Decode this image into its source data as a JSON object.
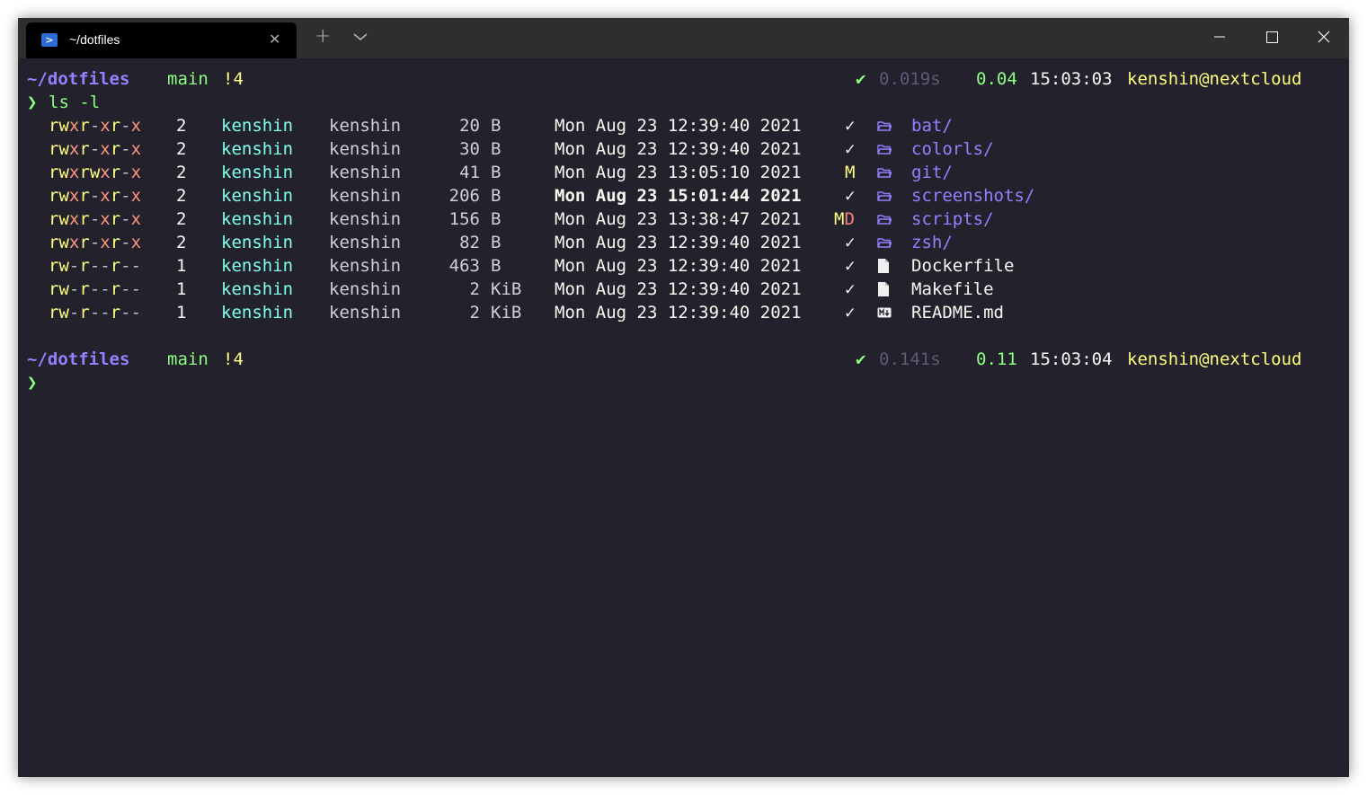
{
  "tab": {
    "title": "~/dotfiles",
    "icon": "powershell-icon",
    "close_glyph": "✕",
    "new_tab_glyph": "+"
  },
  "prompt1": {
    "path": "~/dotfiles",
    "branch_glyph": "",
    "branch": "main",
    "status": "!4",
    "check": "✔",
    "duration": "0.019s",
    "load_glyph": "",
    "load": "0.04",
    "time": "15:03:03",
    "user": "kenshin@nextcloud"
  },
  "command": {
    "chevron": "❯",
    "text": "ls -l"
  },
  "listing": [
    {
      "perm": [
        "r",
        "w",
        "x",
        "r",
        "-",
        "x",
        "r",
        "-",
        "x"
      ],
      "links": "2",
      "user": "kenshin",
      "group": "kenshin",
      "size": "20",
      "unit": "B",
      "date": "Mon Aug 23 12:39:40 2021",
      "recent": false,
      "git": "✓",
      "git_type": "clean",
      "icon": "📂",
      "kind": "dir",
      "name": "bat/"
    },
    {
      "perm": [
        "r",
        "w",
        "x",
        "r",
        "-",
        "x",
        "r",
        "-",
        "x"
      ],
      "links": "2",
      "user": "kenshin",
      "group": "kenshin",
      "size": "30",
      "unit": "B",
      "date": "Mon Aug 23 12:39:40 2021",
      "recent": false,
      "git": "✓",
      "git_type": "clean",
      "icon": "📂",
      "kind": "dir",
      "name": "colorls/"
    },
    {
      "perm": [
        "r",
        "w",
        "x",
        "r",
        "w",
        "x",
        "r",
        "-",
        "x"
      ],
      "links": "2",
      "user": "kenshin",
      "group": "kenshin",
      "size": "41",
      "unit": "B",
      "date": "Mon Aug 23 13:05:10 2021",
      "recent": false,
      "git": "M",
      "git_type": "modified",
      "icon": "📂",
      "kind": "dir",
      "name": "git/"
    },
    {
      "perm": [
        "r",
        "w",
        "x",
        "r",
        "-",
        "x",
        "r",
        "-",
        "x"
      ],
      "links": "2",
      "user": "kenshin",
      "group": "kenshin",
      "size": "206",
      "unit": "B",
      "date": "Mon Aug 23 15:01:44 2021",
      "recent": true,
      "git": "✓",
      "git_type": "clean",
      "icon": "📂",
      "kind": "dir",
      "name": "screenshots/"
    },
    {
      "perm": [
        "r",
        "w",
        "x",
        "r",
        "-",
        "x",
        "r",
        "-",
        "x"
      ],
      "links": "2",
      "user": "kenshin",
      "group": "kenshin",
      "size": "156",
      "unit": "B",
      "date": "Mon Aug 23 13:38:47 2021",
      "recent": false,
      "git": "MD",
      "git_type": "modified-deleted",
      "icon": "📂",
      "kind": "dir",
      "name": "scripts/"
    },
    {
      "perm": [
        "r",
        "w",
        "x",
        "r",
        "-",
        "x",
        "r",
        "-",
        "x"
      ],
      "links": "2",
      "user": "kenshin",
      "group": "kenshin",
      "size": "82",
      "unit": "B",
      "date": "Mon Aug 23 12:39:40 2021",
      "recent": false,
      "git": "✓",
      "git_type": "clean",
      "icon": "📂",
      "kind": "dir",
      "name": "zsh/"
    },
    {
      "perm": [
        "r",
        "w",
        "-",
        "r",
        "-",
        "-",
        "r",
        "-",
        "-"
      ],
      "links": "1",
      "user": "kenshin",
      "group": "kenshin",
      "size": "463",
      "unit": "B",
      "date": "Mon Aug 23 12:39:40 2021",
      "recent": false,
      "git": "✓",
      "git_type": "clean",
      "icon": "📄",
      "kind": "file",
      "name": "Dockerfile"
    },
    {
      "perm": [
        "r",
        "w",
        "-",
        "r",
        "-",
        "-",
        "r",
        "-",
        "-"
      ],
      "links": "1",
      "user": "kenshin",
      "group": "kenshin",
      "size": "2",
      "unit": "KiB",
      "date": "Mon Aug 23 12:39:40 2021",
      "recent": false,
      "git": "✓",
      "git_type": "clean",
      "icon": "📄",
      "kind": "file",
      "name": "Makefile"
    },
    {
      "perm": [
        "r",
        "w",
        "-",
        "r",
        "-",
        "-",
        "r",
        "-",
        "-"
      ],
      "links": "1",
      "user": "kenshin",
      "group": "kenshin",
      "size": "2",
      "unit": "KiB",
      "date": "Mon Aug 23 12:39:40 2021",
      "recent": false,
      "git": "✓",
      "git_type": "clean",
      "icon": "▣",
      "kind": "markdown",
      "name": "README.md"
    }
  ],
  "prompt2": {
    "path": "~/dotfiles",
    "branch_glyph": "",
    "branch": "main",
    "status": "!4",
    "check": "✔",
    "duration": "0.141s",
    "load_glyph": "",
    "load": "0.11",
    "time": "15:03:04",
    "user": "kenshin@nextcloud"
  },
  "cursor_prompt": {
    "chevron": "❯"
  },
  "colors": {
    "background": "#22212c",
    "titlebar": "#2e2e2e",
    "purple": "#9580ff",
    "green": "#8aff80",
    "yellow": "#ffff80",
    "cyan": "#80ffea",
    "red": "#ff7f7f"
  }
}
